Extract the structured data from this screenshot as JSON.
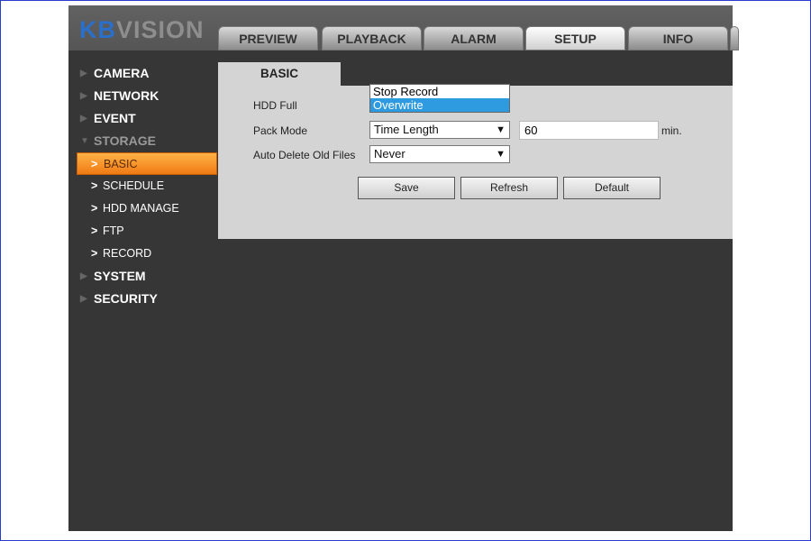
{
  "logo": {
    "kb": "KB",
    "vision": "VISION"
  },
  "tabs": [
    "PREVIEW",
    "PLAYBACK",
    "ALARM",
    "SETUP",
    "INFO"
  ],
  "active_tab": "SETUP",
  "sidebar": {
    "sections": [
      "CAMERA",
      "NETWORK",
      "EVENT",
      "STORAGE",
      "SYSTEM",
      "SECURITY"
    ],
    "storage_items": [
      "BASIC",
      "SCHEDULE",
      "HDD MANAGE",
      "FTP",
      "RECORD"
    ],
    "active_item": "BASIC"
  },
  "page_tab": "BASIC",
  "form": {
    "hdd_full_label": "HDD Full",
    "hdd_full_options": [
      "Stop Record",
      "Overwrite"
    ],
    "hdd_full_highlighted": "Overwrite",
    "pack_mode_label": "Pack Mode",
    "pack_mode_value": "Time Length",
    "pack_length_value": "60",
    "pack_length_unit": "min.",
    "auto_delete_label": "Auto Delete Old Files",
    "auto_delete_value": "Never"
  },
  "buttons": {
    "save": "Save",
    "refresh": "Refresh",
    "default": "Default"
  },
  "colors": {
    "accent": "#f07a14",
    "highlight": "#2e9be0",
    "logo_blue": "#2a6fc9"
  }
}
